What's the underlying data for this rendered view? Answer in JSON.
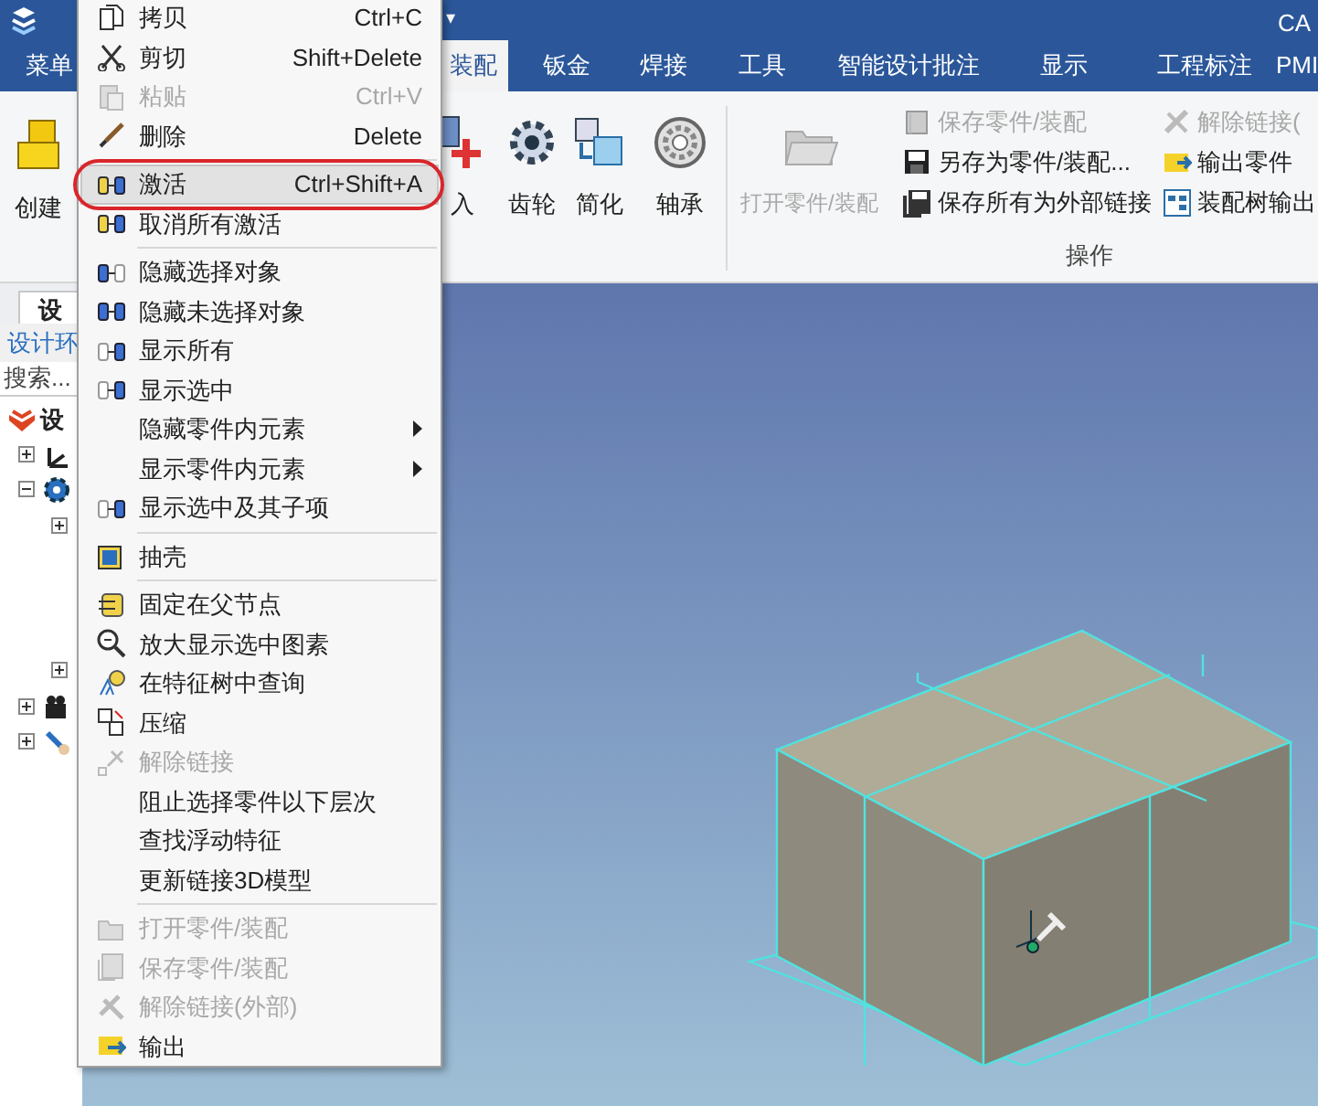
{
  "title_bar": {
    "title": "CA",
    "quick_access_caret": "▾"
  },
  "tabs": [
    {
      "label": "菜单",
      "selected": false
    },
    {
      "label": "装配",
      "selected": true
    },
    {
      "label": "钣金",
      "selected": false
    },
    {
      "label": "焊接",
      "selected": false
    },
    {
      "label": "工具",
      "selected": false
    },
    {
      "label": "智能设计批注",
      "selected": false
    },
    {
      "label": "显示",
      "selected": false
    },
    {
      "label": "工程标注",
      "selected": false
    },
    {
      "label": "PMI",
      "selected": false
    }
  ],
  "ribbon": {
    "left_button": {
      "label": "创建"
    },
    "large_buttons": [
      {
        "label": "入",
        "disabled": false
      },
      {
        "label": "齿轮",
        "disabled": false
      },
      {
        "label": "简化",
        "disabled": false
      },
      {
        "label": "轴承",
        "disabled": false
      }
    ],
    "operations_group": {
      "open_button": {
        "label": "打开零件/装配",
        "disabled": true
      },
      "small_buttons": [
        {
          "label": "保存零件/装配",
          "disabled": true
        },
        {
          "label": "另存为零件/装配...",
          "disabled": false
        },
        {
          "label": "保存所有为外部链接",
          "disabled": false
        },
        {
          "label": "解除链接(",
          "disabled": true
        },
        {
          "label": "输出零件",
          "disabled": false
        },
        {
          "label": "装配树输出",
          "disabled": false
        }
      ],
      "group_label": "操作"
    }
  },
  "left_panel": {
    "tab": "设",
    "header": "设计环",
    "search": {
      "placeholder": "搜索..."
    },
    "tree": [
      {
        "label": "设",
        "children": [
          {
            "expanded": false
          },
          {
            "expanded": true,
            "children": [
              {
                "expanded": false
              },
              {
                "expanded": false
              }
            ]
          },
          {
            "expanded": false
          },
          {
            "expanded": false
          }
        ]
      }
    ]
  },
  "context_menu": [
    {
      "kind": "item",
      "label": "拷贝",
      "shortcut": "Ctrl+C",
      "disabled": false,
      "selected": false
    },
    {
      "kind": "item",
      "label": "剪切",
      "shortcut": "Shift+Delete",
      "disabled": false,
      "selected": false
    },
    {
      "kind": "item",
      "label": "粘贴",
      "shortcut": "Ctrl+V",
      "disabled": true,
      "selected": false
    },
    {
      "kind": "item",
      "label": "删除",
      "shortcut": "Delete",
      "disabled": false,
      "selected": false
    },
    {
      "kind": "separator"
    },
    {
      "kind": "item",
      "label": "激活",
      "shortcut": "Ctrl+Shift+A",
      "disabled": false,
      "selected": true
    },
    {
      "kind": "item",
      "label": "取消所有激活",
      "disabled": false,
      "selected": false
    },
    {
      "kind": "separator"
    },
    {
      "kind": "item",
      "label": "隐藏选择对象",
      "disabled": false,
      "selected": false
    },
    {
      "kind": "item",
      "label": "隐藏未选择对象",
      "disabled": false,
      "selected": false
    },
    {
      "kind": "item",
      "label": "显示所有",
      "disabled": false,
      "selected": false
    },
    {
      "kind": "item",
      "label": "显示选中",
      "disabled": false,
      "selected": false
    },
    {
      "kind": "item",
      "label": "隐藏零件内元素",
      "disabled": false,
      "selected": false,
      "submenu": true
    },
    {
      "kind": "item",
      "label": "显示零件内元素",
      "disabled": false,
      "selected": false,
      "submenu": true
    },
    {
      "kind": "item",
      "label": "显示选中及其子项",
      "disabled": false,
      "selected": false
    },
    {
      "kind": "separator"
    },
    {
      "kind": "item",
      "label": "抽壳",
      "disabled": false,
      "selected": false
    },
    {
      "kind": "separator"
    },
    {
      "kind": "item",
      "label": "固定在父节点",
      "disabled": false,
      "selected": false
    },
    {
      "kind": "item",
      "label": "放大显示选中图素",
      "disabled": false,
      "selected": false
    },
    {
      "kind": "item",
      "label": "在特征树中查询",
      "disabled": false,
      "selected": false
    },
    {
      "kind": "item",
      "label": "压缩",
      "disabled": false,
      "selected": false
    },
    {
      "kind": "item",
      "label": "解除链接",
      "disabled": true,
      "selected": false
    },
    {
      "kind": "item",
      "label": "阻止选择零件以下层次",
      "disabled": false,
      "selected": false
    },
    {
      "kind": "item",
      "label": "查找浮动特征",
      "disabled": false,
      "selected": false
    },
    {
      "kind": "item",
      "label": "更新链接3D模型",
      "disabled": false,
      "selected": false
    },
    {
      "kind": "separator"
    },
    {
      "kind": "item",
      "label": "打开零件/装配",
      "disabled": true,
      "selected": false
    },
    {
      "kind": "item",
      "label": "保存零件/装配",
      "disabled": true,
      "selected": false
    },
    {
      "kind": "item",
      "label": "解除链接(外部)",
      "disabled": true,
      "selected": false
    },
    {
      "kind": "item",
      "label": "输出",
      "disabled": false,
      "selected": false
    }
  ]
}
